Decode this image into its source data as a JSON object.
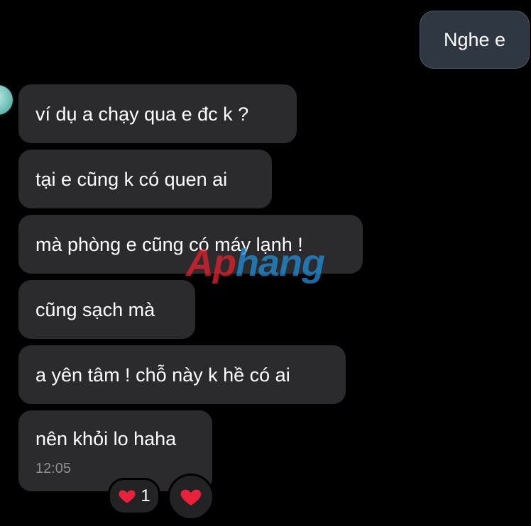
{
  "sent": [
    {
      "text": "Nghe e"
    }
  ],
  "received": [
    {
      "text": "ví dụ a chạy qua e đc k ?"
    },
    {
      "text": "tại e cũng k có quen ai"
    },
    {
      "text": "mà phòng e cũng có máy lạnh !"
    },
    {
      "text": "cũng sạch mà"
    },
    {
      "text": "a yên tâm ! chỗ này k hề có ai"
    },
    {
      "text": "nên khỏi lo haha",
      "time": "12:05"
    }
  ],
  "reactions": {
    "heart_count_label": "1"
  },
  "watermark": {
    "part1": "Ap",
    "part2": "hang"
  },
  "colors": {
    "background": "#000000",
    "received_bubble": "#2b2b2d",
    "sent_bubble": "#2e3742",
    "heart": "#e8223b"
  },
  "icons": [
    "avatar",
    "heart-icon",
    "heart-icon"
  ]
}
